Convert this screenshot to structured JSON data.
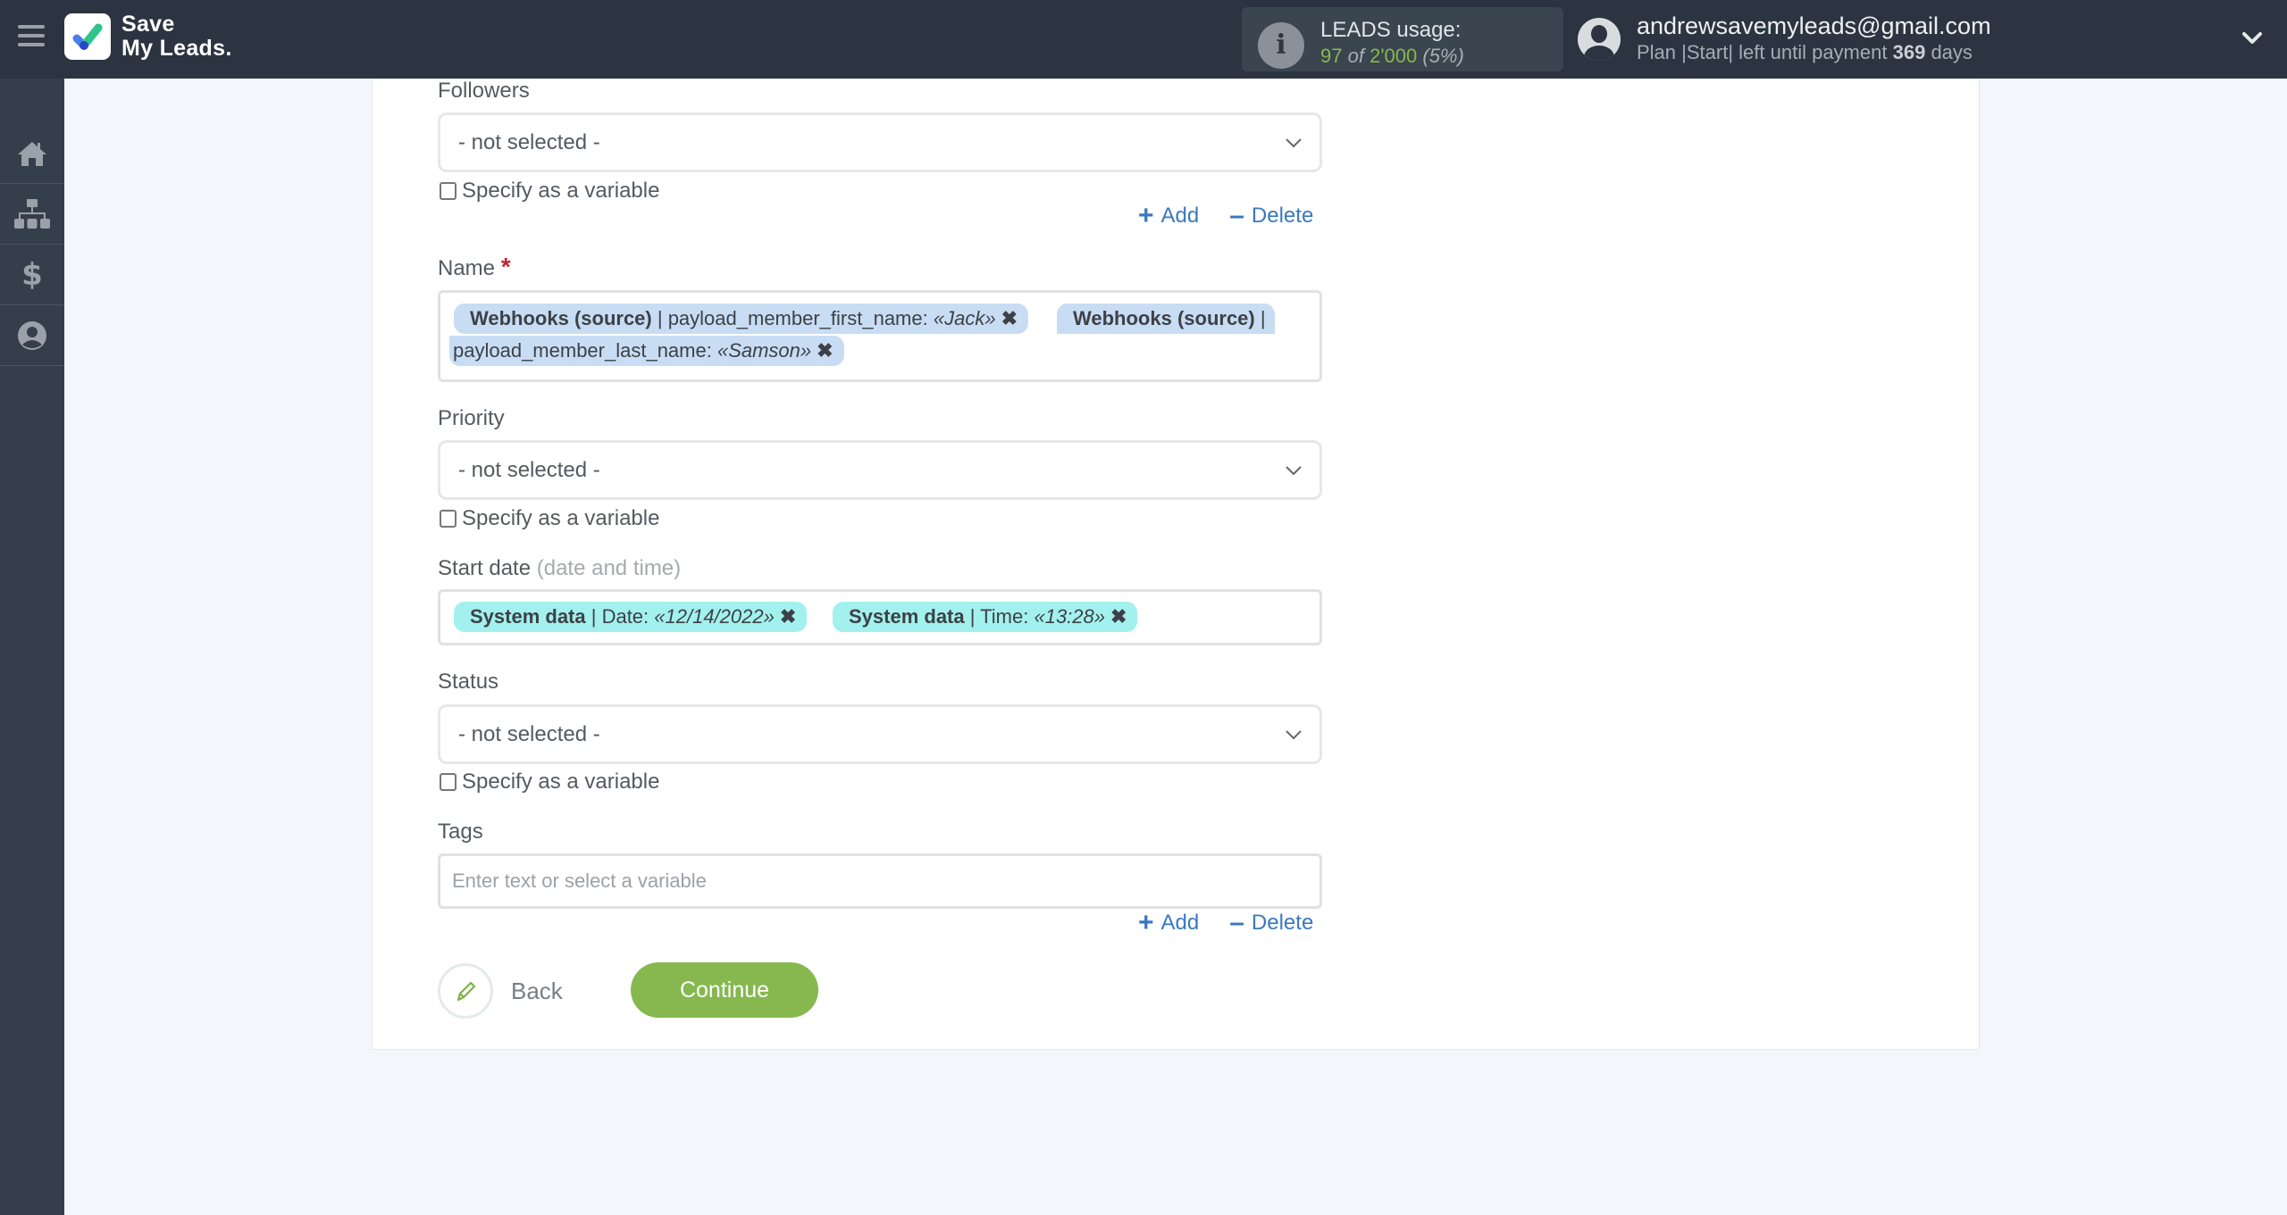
{
  "header": {
    "logo_line1": "Save",
    "logo_line2": "My Leads.",
    "usage_title": "LEADS usage:",
    "usage_used": "97",
    "usage_of": "of",
    "usage_total": "2'000",
    "usage_percent": "(5%)",
    "email": "andrewsavemyleads@gmail.com",
    "plan_prefix": "Plan |Start| left until payment",
    "plan_days": "369",
    "plan_suffix": "days"
  },
  "sidebar": {
    "items": [
      {
        "name": "home",
        "icon": "home-icon"
      },
      {
        "name": "connections",
        "icon": "sitemap-icon"
      },
      {
        "name": "billing",
        "icon": "dollar-icon"
      },
      {
        "name": "account",
        "icon": "user-circle-icon"
      }
    ]
  },
  "form": {
    "followers": {
      "label": "Followers",
      "value": "- not selected -",
      "variable_label": "Specify as a variable",
      "add_label": "Add",
      "delete_label": "Delete"
    },
    "name": {
      "label": "Name",
      "required_mark": "*",
      "chips": [
        {
          "source": "Webhooks (source)",
          "field": " | payload_member_first_name: ",
          "value": "«Jack»",
          "remove": "✖"
        },
        {
          "source": "Webhooks (source)",
          "field_line1": " |",
          "field_line2": "payload_member_last_name: ",
          "value": "«Samson»",
          "remove": "✖"
        }
      ]
    },
    "priority": {
      "label": "Priority",
      "value": "- not selected -",
      "variable_label": "Specify as a variable"
    },
    "start_date": {
      "label": "Start date",
      "hint": "(date and time)",
      "chips": [
        {
          "source": "System data",
          "field": " | Date: ",
          "value": "«12/14/2022»",
          "remove": "✖"
        },
        {
          "source": "System data",
          "field": " | Time: ",
          "value": "«13:28»",
          "remove": "✖"
        }
      ]
    },
    "status": {
      "label": "Status",
      "value": "- not selected -",
      "variable_label": "Specify as a variable"
    },
    "tags": {
      "label": "Tags",
      "placeholder": "Enter text or select a variable",
      "value": "",
      "add_label": "Add",
      "delete_label": "Delete"
    },
    "back_label": "Back",
    "continue_label": "Continue"
  },
  "colors": {
    "header_bg": "#2b3440",
    "sidebar_bg": "#353f4c",
    "accent_green": "#86b84f",
    "link_blue": "#3a78c0",
    "chip_blue": "#c8ddf4",
    "chip_cyan": "#a2f1ee",
    "required_red": "#c0262d"
  }
}
